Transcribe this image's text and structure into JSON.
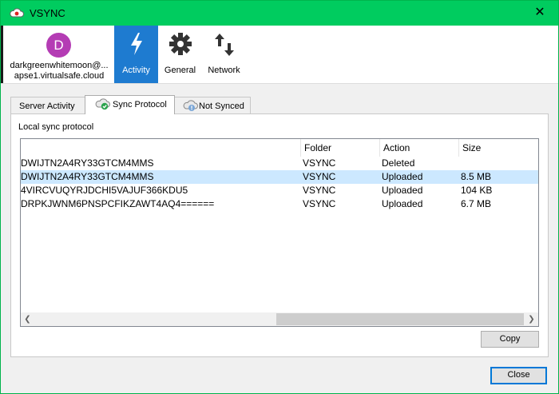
{
  "window": {
    "title": "VSYNC",
    "close_glyph": "✕"
  },
  "account": {
    "avatar_letter": "D",
    "name_line1": "darkgreenwhitemoon@...",
    "name_line2": "apse1.virtualsafe.cloud",
    "avatar_color": "#b43cb4"
  },
  "nav": [
    {
      "label": "Activity",
      "icon": "lightning-icon",
      "active": true
    },
    {
      "label": "General",
      "icon": "gear-icon",
      "active": false
    },
    {
      "label": "Network",
      "icon": "transfer-arrows-icon",
      "active": false
    }
  ],
  "tabs": [
    {
      "label": "Server Activity",
      "icon": null
    },
    {
      "label": "Sync Protocol",
      "icon": "cloud-check-icon",
      "active": true
    },
    {
      "label": "Not Synced",
      "icon": "cloud-warning-icon"
    }
  ],
  "section_label": "Local sync protocol",
  "table": {
    "columns": [
      "",
      "Folder",
      "Action",
      "Size"
    ],
    "rows": [
      {
        "name": "DWIJTN2A4RY33GTCM4MMS",
        "folder": "VSYNC",
        "action": "Deleted",
        "size": ""
      },
      {
        "name": "DWIJTN2A4RY33GTCM4MMS",
        "folder": "VSYNC",
        "action": "Uploaded",
        "size": "8.5 MB",
        "selected": true
      },
      {
        "name": "4VIRCVUQYRJDCHI5VAJUF366KDU5",
        "folder": "VSYNC",
        "action": "Uploaded",
        "size": "104 KB"
      },
      {
        "name": "DRPKJWNM6PNSPCFIKZAWT4AQ4======",
        "folder": "VSYNC",
        "action": "Uploaded",
        "size": "6.7 MB"
      }
    ]
  },
  "buttons": {
    "copy": "Copy",
    "close": "Close"
  },
  "colors": {
    "titlebar": "#00cc5f",
    "accent": "#1e7bd0",
    "selection": "#cce8ff"
  }
}
